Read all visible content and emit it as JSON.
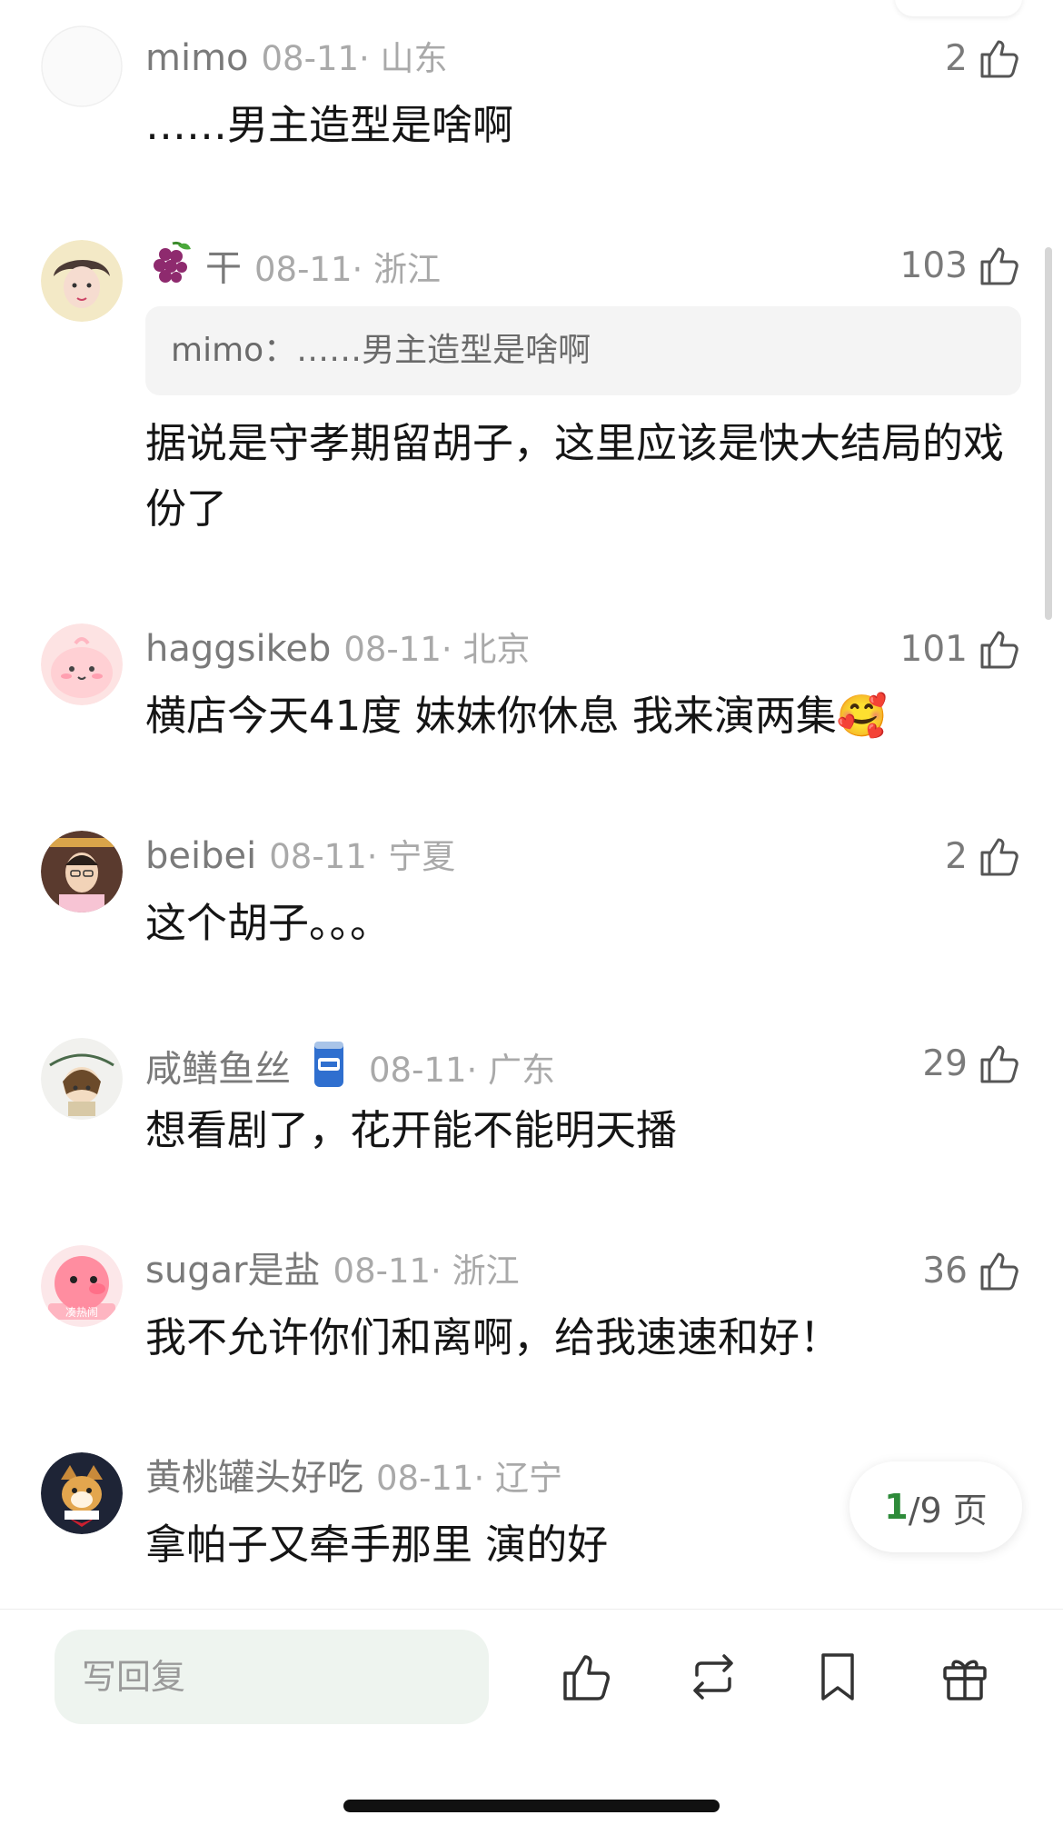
{
  "comments": [
    {
      "name": "mimo",
      "time": "08-11· 山东",
      "likes": "2",
      "text": "……男主造型是啥啊"
    },
    {
      "name": "干",
      "name_emoji": "grape-emoji",
      "time": "08-11· 浙江",
      "likes": "103",
      "quote": "mimo：……男主造型是啥啊",
      "text": "据说是守孝期留胡子，这里应该是快大结局的戏份了"
    },
    {
      "name": "haggsikeb",
      "time": "08-11· 北京",
      "likes": "101",
      "text": "横店今天41度 妹妹你休息 我来演两集",
      "text_emoji": "🥰"
    },
    {
      "name": "beibei",
      "time": "08-11· 宁夏",
      "likes": "2",
      "text": "这个胡子。。。"
    },
    {
      "name": "咸鳝鱼丝",
      "badge": "can-badge-icon",
      "time": "08-11· 广东",
      "likes": "29",
      "text": "想看剧了，花开能不能明天播"
    },
    {
      "name": "sugar是盐",
      "time": "08-11· 浙江",
      "likes": "36",
      "text": "我不允许你们和离啊，给我速速和好！",
      "avatar_label": "凑热闹"
    },
    {
      "name": "黄桃罐头好吃",
      "time": "08-11· 辽宁",
      "likes": "",
      "text": "拿帕子又牵手那里 演的好"
    }
  ],
  "pager": {
    "current": "1",
    "total": "/9 页"
  },
  "bottom_bar": {
    "reply_placeholder": "写回复"
  },
  "colors": {
    "accent": "#2e8b3a",
    "meta": "#7a7a7a",
    "time": "#a9a9a9"
  }
}
